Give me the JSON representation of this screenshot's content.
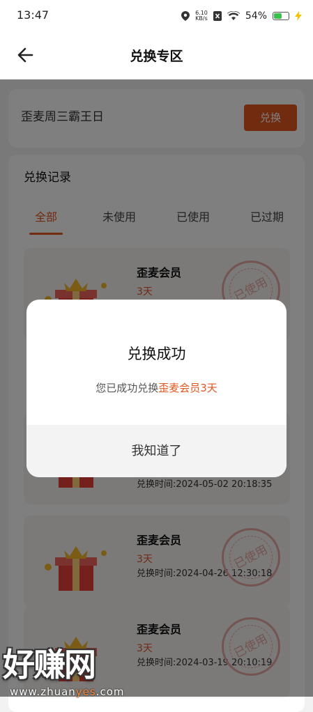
{
  "status_bar": {
    "time": "13:47",
    "net_speed_value": "6.10",
    "net_speed_unit": "KB/s",
    "battery_text": "54%",
    "battery_level": 0.54
  },
  "header": {
    "title": "兑换专区"
  },
  "redeem": {
    "code_value": "歪麦周三霸王日",
    "button_label": "兑换"
  },
  "records": {
    "title": "兑换记录",
    "tabs": [
      "全部",
      "未使用",
      "已使用",
      "已过期"
    ],
    "items": [
      {
        "name": "歪麦会员",
        "duration": "3天",
        "time": "",
        "stamp": "已使用"
      },
      {
        "name": "",
        "duration": "",
        "time": "兑换时间:2024-05-02 20:18:35",
        "stamp": ""
      },
      {
        "name": "歪麦会员",
        "duration": "3天",
        "time": "兑换时间:2024-04-26 12:30:18",
        "stamp": "已使用"
      },
      {
        "name": "歪麦会员",
        "duration": "3天",
        "time": "兑换时间:2024-03-19 20:10:19",
        "stamp": "已使用"
      }
    ]
  },
  "dialog": {
    "title": "兑换成功",
    "message_prefix": "您已成功兑换",
    "message_highlight": "歪麦会员3天",
    "button_label": "我知道了"
  },
  "watermark": {
    "text": "好赚网",
    "url_prefix": "www.zhuan",
    "url_highlight": "yes",
    "url_suffix": ".com"
  },
  "colors": {
    "accent": "#e2561f",
    "overlay": "rgba(0,0,0,0.5)"
  }
}
